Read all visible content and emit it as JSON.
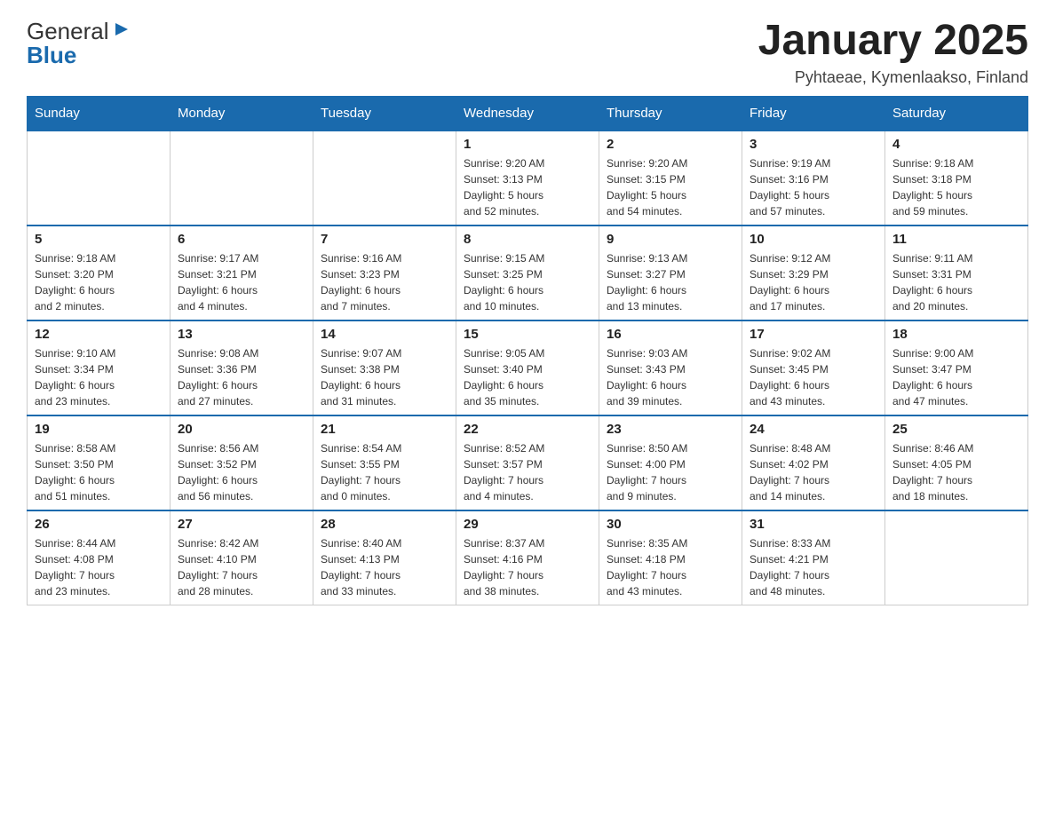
{
  "header": {
    "logo_general": "General",
    "logo_blue": "Blue",
    "title": "January 2025",
    "subtitle": "Pyhtaeae, Kymenlaakso, Finland"
  },
  "calendar": {
    "days_of_week": [
      "Sunday",
      "Monday",
      "Tuesday",
      "Wednesday",
      "Thursday",
      "Friday",
      "Saturday"
    ],
    "weeks": [
      [
        {
          "day": "",
          "info": ""
        },
        {
          "day": "",
          "info": ""
        },
        {
          "day": "",
          "info": ""
        },
        {
          "day": "1",
          "info": "Sunrise: 9:20 AM\nSunset: 3:13 PM\nDaylight: 5 hours\nand 52 minutes."
        },
        {
          "day": "2",
          "info": "Sunrise: 9:20 AM\nSunset: 3:15 PM\nDaylight: 5 hours\nand 54 minutes."
        },
        {
          "day": "3",
          "info": "Sunrise: 9:19 AM\nSunset: 3:16 PM\nDaylight: 5 hours\nand 57 minutes."
        },
        {
          "day": "4",
          "info": "Sunrise: 9:18 AM\nSunset: 3:18 PM\nDaylight: 5 hours\nand 59 minutes."
        }
      ],
      [
        {
          "day": "5",
          "info": "Sunrise: 9:18 AM\nSunset: 3:20 PM\nDaylight: 6 hours\nand 2 minutes."
        },
        {
          "day": "6",
          "info": "Sunrise: 9:17 AM\nSunset: 3:21 PM\nDaylight: 6 hours\nand 4 minutes."
        },
        {
          "day": "7",
          "info": "Sunrise: 9:16 AM\nSunset: 3:23 PM\nDaylight: 6 hours\nand 7 minutes."
        },
        {
          "day": "8",
          "info": "Sunrise: 9:15 AM\nSunset: 3:25 PM\nDaylight: 6 hours\nand 10 minutes."
        },
        {
          "day": "9",
          "info": "Sunrise: 9:13 AM\nSunset: 3:27 PM\nDaylight: 6 hours\nand 13 minutes."
        },
        {
          "day": "10",
          "info": "Sunrise: 9:12 AM\nSunset: 3:29 PM\nDaylight: 6 hours\nand 17 minutes."
        },
        {
          "day": "11",
          "info": "Sunrise: 9:11 AM\nSunset: 3:31 PM\nDaylight: 6 hours\nand 20 minutes."
        }
      ],
      [
        {
          "day": "12",
          "info": "Sunrise: 9:10 AM\nSunset: 3:34 PM\nDaylight: 6 hours\nand 23 minutes."
        },
        {
          "day": "13",
          "info": "Sunrise: 9:08 AM\nSunset: 3:36 PM\nDaylight: 6 hours\nand 27 minutes."
        },
        {
          "day": "14",
          "info": "Sunrise: 9:07 AM\nSunset: 3:38 PM\nDaylight: 6 hours\nand 31 minutes."
        },
        {
          "day": "15",
          "info": "Sunrise: 9:05 AM\nSunset: 3:40 PM\nDaylight: 6 hours\nand 35 minutes."
        },
        {
          "day": "16",
          "info": "Sunrise: 9:03 AM\nSunset: 3:43 PM\nDaylight: 6 hours\nand 39 minutes."
        },
        {
          "day": "17",
          "info": "Sunrise: 9:02 AM\nSunset: 3:45 PM\nDaylight: 6 hours\nand 43 minutes."
        },
        {
          "day": "18",
          "info": "Sunrise: 9:00 AM\nSunset: 3:47 PM\nDaylight: 6 hours\nand 47 minutes."
        }
      ],
      [
        {
          "day": "19",
          "info": "Sunrise: 8:58 AM\nSunset: 3:50 PM\nDaylight: 6 hours\nand 51 minutes."
        },
        {
          "day": "20",
          "info": "Sunrise: 8:56 AM\nSunset: 3:52 PM\nDaylight: 6 hours\nand 56 minutes."
        },
        {
          "day": "21",
          "info": "Sunrise: 8:54 AM\nSunset: 3:55 PM\nDaylight: 7 hours\nand 0 minutes."
        },
        {
          "day": "22",
          "info": "Sunrise: 8:52 AM\nSunset: 3:57 PM\nDaylight: 7 hours\nand 4 minutes."
        },
        {
          "day": "23",
          "info": "Sunrise: 8:50 AM\nSunset: 4:00 PM\nDaylight: 7 hours\nand 9 minutes."
        },
        {
          "day": "24",
          "info": "Sunrise: 8:48 AM\nSunset: 4:02 PM\nDaylight: 7 hours\nand 14 minutes."
        },
        {
          "day": "25",
          "info": "Sunrise: 8:46 AM\nSunset: 4:05 PM\nDaylight: 7 hours\nand 18 minutes."
        }
      ],
      [
        {
          "day": "26",
          "info": "Sunrise: 8:44 AM\nSunset: 4:08 PM\nDaylight: 7 hours\nand 23 minutes."
        },
        {
          "day": "27",
          "info": "Sunrise: 8:42 AM\nSunset: 4:10 PM\nDaylight: 7 hours\nand 28 minutes."
        },
        {
          "day": "28",
          "info": "Sunrise: 8:40 AM\nSunset: 4:13 PM\nDaylight: 7 hours\nand 33 minutes."
        },
        {
          "day": "29",
          "info": "Sunrise: 8:37 AM\nSunset: 4:16 PM\nDaylight: 7 hours\nand 38 minutes."
        },
        {
          "day": "30",
          "info": "Sunrise: 8:35 AM\nSunset: 4:18 PM\nDaylight: 7 hours\nand 43 minutes."
        },
        {
          "day": "31",
          "info": "Sunrise: 8:33 AM\nSunset: 4:21 PM\nDaylight: 7 hours\nand 48 minutes."
        },
        {
          "day": "",
          "info": ""
        }
      ]
    ]
  }
}
